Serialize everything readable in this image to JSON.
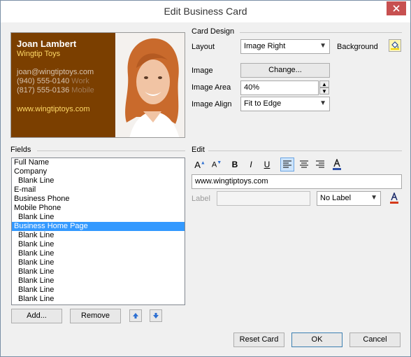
{
  "window": {
    "title": "Edit Business Card"
  },
  "card": {
    "name": "Joan Lambert",
    "company": "Wingtip Toys",
    "email": "joan@wingtiptoys.com",
    "phone1": "(940) 555-0140",
    "phone1_label": "Work",
    "phone2": "(817) 555-0136",
    "phone2_label": "Mobile",
    "website": "www.wingtiptoys.com"
  },
  "card_design": {
    "heading": "Card Design",
    "layout_label": "Layout",
    "layout_value": "Image Right",
    "background_label": "Background",
    "image_label": "Image",
    "change_button": "Change...",
    "image_area_label": "Image Area",
    "image_area_value": "40%",
    "image_align_label": "Image Align",
    "image_align_value": "Fit to Edge"
  },
  "fields": {
    "heading": "Fields",
    "items": [
      {
        "label": "Full Name",
        "indent": false,
        "selected": false
      },
      {
        "label": "Company",
        "indent": false,
        "selected": false
      },
      {
        "label": "Blank Line",
        "indent": true,
        "selected": false
      },
      {
        "label": "E-mail",
        "indent": false,
        "selected": false
      },
      {
        "label": "Business Phone",
        "indent": false,
        "selected": false
      },
      {
        "label": "Mobile Phone",
        "indent": false,
        "selected": false
      },
      {
        "label": "Blank Line",
        "indent": true,
        "selected": false
      },
      {
        "label": "Business Home Page",
        "indent": false,
        "selected": true
      },
      {
        "label": "Blank Line",
        "indent": true,
        "selected": false
      },
      {
        "label": "Blank Line",
        "indent": true,
        "selected": false
      },
      {
        "label": "Blank Line",
        "indent": true,
        "selected": false
      },
      {
        "label": "Blank Line",
        "indent": true,
        "selected": false
      },
      {
        "label": "Blank Line",
        "indent": true,
        "selected": false
      },
      {
        "label": "Blank Line",
        "indent": true,
        "selected": false
      },
      {
        "label": "Blank Line",
        "indent": true,
        "selected": false
      },
      {
        "label": "Blank Line",
        "indent": true,
        "selected": false
      }
    ],
    "add_button": "Add...",
    "remove_button": "Remove"
  },
  "edit": {
    "heading": "Edit",
    "text_value": "www.wingtiptoys.com",
    "label_label": "Label",
    "label_value": "",
    "label_position": "No Label",
    "tools": {
      "bold": "B",
      "italic": "I",
      "underline": "U"
    }
  },
  "footer": {
    "reset_button": "Reset Card",
    "ok_button": "OK",
    "cancel_button": "Cancel"
  },
  "colors": {
    "card_bg": "#7b3f00",
    "card_name": "#ffffff",
    "card_accent": "#ffd966",
    "selection": "#3399ff",
    "close_button": "#c75050"
  }
}
